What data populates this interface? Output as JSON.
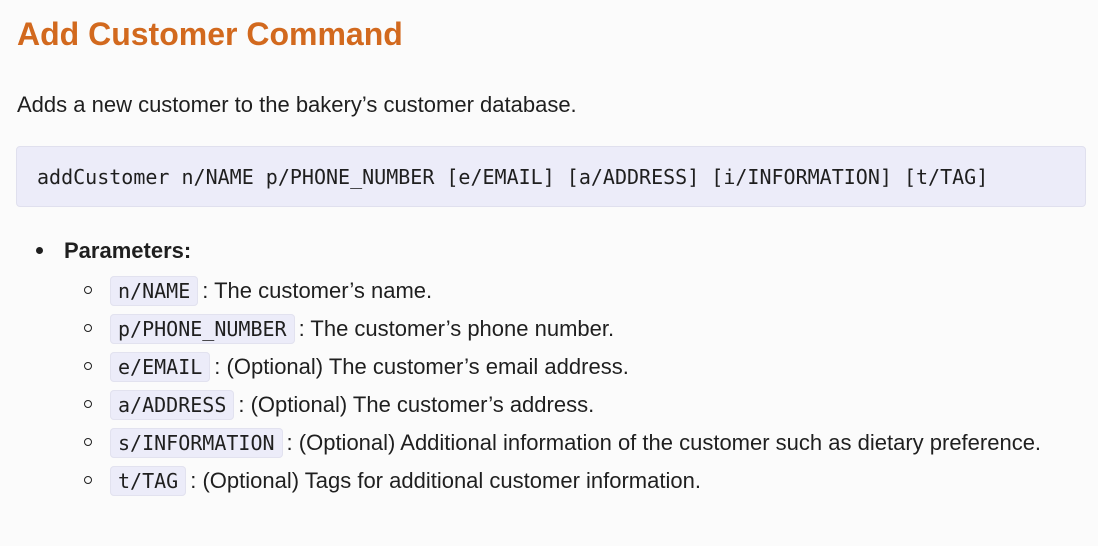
{
  "heading": "Add Customer Command",
  "description": "Adds a new customer to the bakery’s customer database.",
  "command_format": "addCustomer n/NAME p/PHONE_NUMBER [e/EMAIL] [a/ADDRESS] [i/INFORMATION] [t/TAG]",
  "parameters": {
    "label": "Parameters:",
    "items": [
      {
        "code": "n/NAME",
        "text": ": The customer’s name."
      },
      {
        "code": "p/PHONE_NUMBER",
        "text": ": The customer’s phone number."
      },
      {
        "code": "e/EMAIL",
        "text": ": (Optional) The customer’s email address."
      },
      {
        "code": "a/ADDRESS",
        "text": ": (Optional) The customer’s address."
      },
      {
        "code": "s/INFORMATION",
        "text": ": (Optional) Additional information of the customer such as dietary preference."
      },
      {
        "code": "t/TAG",
        "text": ": (Optional) Tags for additional customer information."
      }
    ]
  },
  "colors": {
    "heading": "#d2691e",
    "code_background": "#ececf9",
    "text": "#1f1f1f",
    "page_background": "#fbfbfb"
  }
}
